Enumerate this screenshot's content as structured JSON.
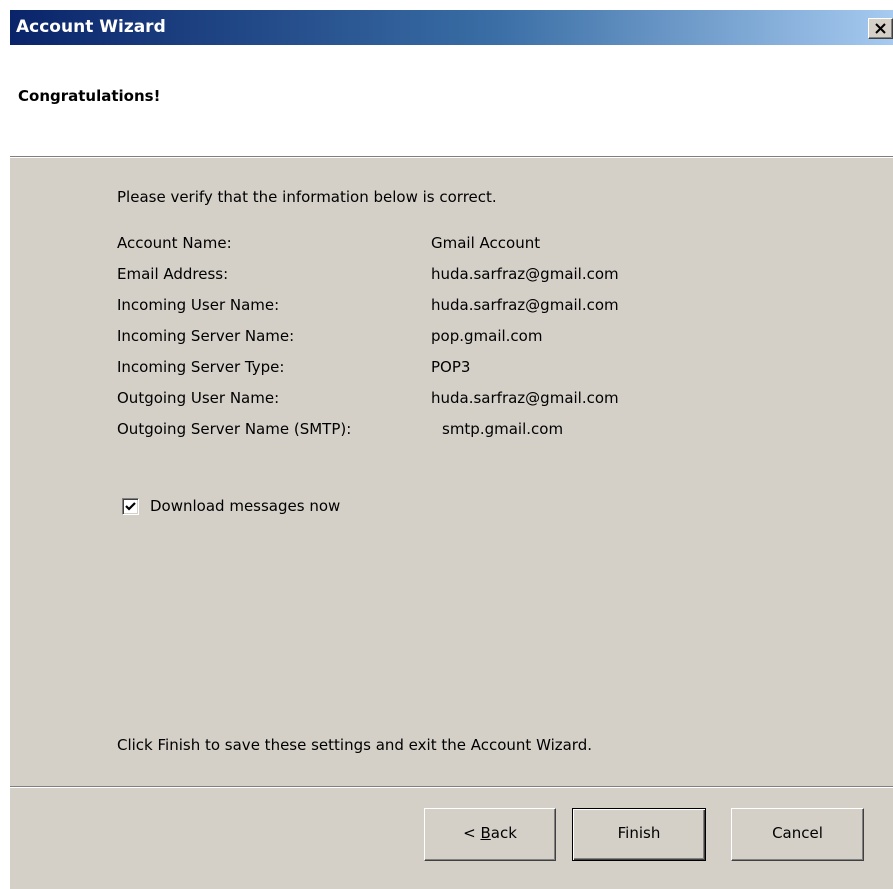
{
  "window": {
    "title": "Account Wizard",
    "close_label": "X"
  },
  "header": {
    "title": "Congratulations!"
  },
  "body": {
    "intro": "Please verify that the information below is correct.",
    "rows": [
      {
        "label": "Account Name:",
        "value": "Gmail Account"
      },
      {
        "label": "Email Address:",
        "value": "huda.sarfraz@gmail.com"
      },
      {
        "label": "Incoming User Name:",
        "value": "huda.sarfraz@gmail.com"
      },
      {
        "label": "Incoming Server Name:",
        "value": "pop.gmail.com"
      },
      {
        "label": "Incoming Server Type:",
        "value": "POP3"
      },
      {
        "label": "Outgoing User Name:",
        "value": "huda.sarfraz@gmail.com"
      },
      {
        "label": "Outgoing Server Name (SMTP):",
        "value": "smtp.gmail.com"
      }
    ],
    "download_checkbox": {
      "label": "Download messages now",
      "checked": true
    },
    "finish_note": "Click Finish to save these settings and exit the Account Wizard."
  },
  "buttons": {
    "back_prefix": "< ",
    "back_accel": "B",
    "back_rest": "ack",
    "finish": "Finish",
    "cancel": "Cancel"
  },
  "colors": {
    "titlebar_start": "#0a246a",
    "titlebar_end": "#a6caf0",
    "dialog_face": "#d4d0c8",
    "header_bg": "#ffffff"
  }
}
